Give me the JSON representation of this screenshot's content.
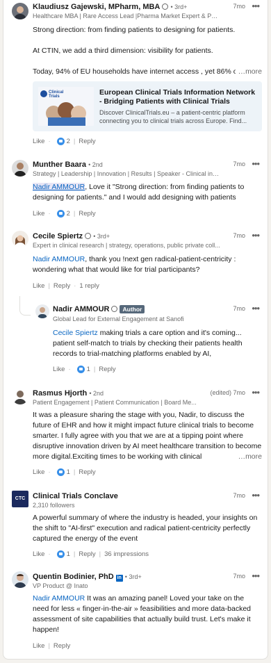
{
  "common": {
    "like_label": "Like",
    "reply_label": "Reply",
    "more_label": "…more"
  },
  "comments": [
    {
      "name": "Klaudiusz Gajewski, MPharm, MBA",
      "degree": "• 3rd+",
      "headline": "Healthcare MBA | Rare Access Lead |Pharma Market Expert & Phar...",
      "time": "7mo",
      "p1": "Strong direction: from finding patients to designing for patients.",
      "p2": "At CTIN, we add a third dimension: visibility for patients.",
      "p3": "Today, 94% of EU households have internet access , yet 86% of",
      "link_title": "European Clinical Trials Information Network - Bridging Patients with Clinical Trials",
      "link_desc": "Discover ClinicalTrials.eu – a patient-centric platform connecting you to clinical trials across Europe. Find...",
      "thumb_text": "Clinical Trials",
      "likes": "2"
    },
    {
      "name": "Munther Baara",
      "degree": "• 2nd",
      "headline": "Strategy | Leadership | Innovation | Results | Speaker - Clinical info...",
      "time": "7mo",
      "mention": "Nadir AMMOUR",
      "text": ", Love it \"Strong direction: from finding patients to designing for patients.\" and I would add designing with patients",
      "likes": "2"
    },
    {
      "name": "Cecile Spiertz",
      "degree": "• 3rd+",
      "headline": "Expert in clinical research | strategy, operations, public private coll...",
      "time": "7mo",
      "mention": "Nadir AMMOUR",
      "text": ", thank you !next gen radical-patient-centricity : wondering what that would like for trial participants?",
      "replies": "1 reply"
    },
    {
      "name": "Nadir AMMOUR",
      "author_badge": "Author",
      "headline": "Global Lead for External Engagement at Sanofi",
      "time": "7mo",
      "mention": "Cecile Spiertz",
      "text": " making trials a care option and it's coming... patient self-match to trials by checking their patients health records to trial-matching platforms enabled by AI,",
      "likes": "1"
    },
    {
      "name": "Rasmus Hjorth",
      "degree": "• 2nd",
      "headline": "Patient Engagement | Patient Communication | Board Me...",
      "time": "(edited) 7mo",
      "text": "It was a pleasure sharing the stage with you, Nadir,  to discuss the future of EHR and how it might impact future clinical trials to become smarter. I fully agree with you that we are at a tipping point where disruptive innovation driven by AI meet healthcare transition to become more digital.Exciting times to be working with clinical",
      "likes": "1"
    },
    {
      "name": "Clinical Trials Conclave",
      "headline": "2,310 followers",
      "time": "7mo",
      "logo_text": "CTC",
      "text": "A powerful summary of where the industry is headed, your insights on the shift to \"AI-first\" execution and radical patient-centricity perfectly captured the energy of the event",
      "likes": "1",
      "impressions": "36 impressions"
    },
    {
      "name": "Quentin Bodinier, PhD",
      "degree": "• 3rd+",
      "headline": "VP Product @ Inato",
      "time": "7mo",
      "mention": "Nadir AMMOUR",
      "text": " It was an amazing panel! Loved your take on the need for less « finger-in-the-air » feasibilities and more data-backed assessment of site capabilities that actually build trust. Let's make it happen!"
    }
  ],
  "colors": {
    "accent": "#0a66c2",
    "like": "#378fe9",
    "author_badge": "#56687a"
  }
}
